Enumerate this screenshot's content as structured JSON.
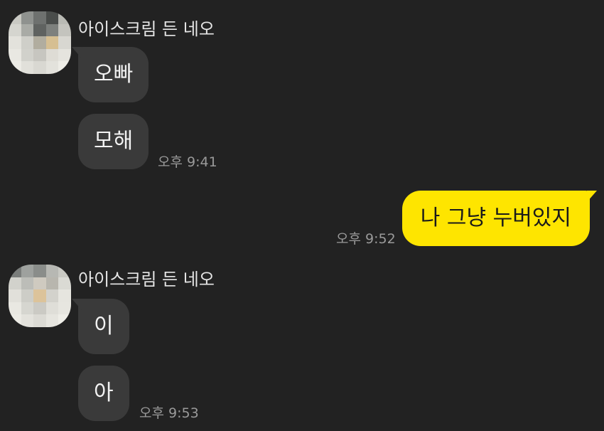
{
  "colors": {
    "background": "#222222",
    "received_bubble": "#3a3a3a",
    "sent_bubble": "#fee500",
    "timestamp": "#9a9a9a"
  },
  "messages": [
    {
      "sender": "아이스크림 든 네오",
      "avatar_icon": "pixelated-profile-icon",
      "bubbles": [
        "오빠",
        "모해"
      ],
      "time": "오후 9:41"
    },
    {
      "sent": true,
      "bubbles": [
        "나 그냥 누버있지"
      ],
      "time": "오후 9:52"
    },
    {
      "sender": "아이스크림 든 네오",
      "avatar_icon": "pixelated-profile-icon",
      "bubbles": [
        "이",
        "아"
      ],
      "time": "오후 9:53"
    }
  ]
}
